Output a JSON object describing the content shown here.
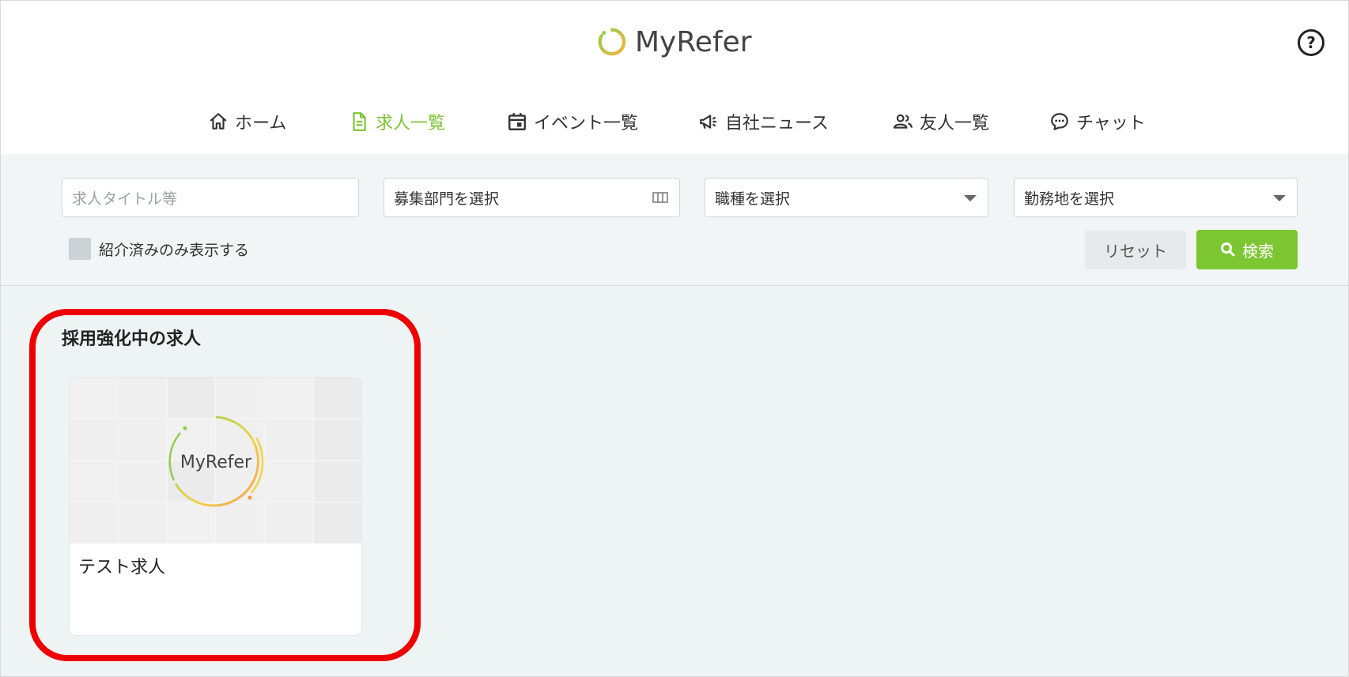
{
  "app": {
    "logo_text": "MyRefer",
    "help_label": "?"
  },
  "nav": {
    "items": [
      {
        "label": "ホーム",
        "icon": "home-icon",
        "active": false
      },
      {
        "label": "求人一覧",
        "icon": "document-icon",
        "active": true
      },
      {
        "label": "イベント一覧",
        "icon": "calendar-icon",
        "active": false
      },
      {
        "label": "自社ニュース",
        "icon": "megaphone-icon",
        "active": false
      },
      {
        "label": "友人一覧",
        "icon": "people-icon",
        "active": false
      },
      {
        "label": "チャット",
        "icon": "chat-icon",
        "active": false
      }
    ]
  },
  "filters": {
    "title_placeholder": "求人タイトル等",
    "department_value": "募集部門を選択",
    "job_type_value": "職種を選択",
    "location_value": "勤務地を選択",
    "referred_only_label": "紹介済みのみ表示する",
    "referred_only_checked": false,
    "reset_label": "リセット",
    "search_label": "検索"
  },
  "featured": {
    "title": "採用強化中の求人",
    "cards": [
      {
        "title": "テスト求人",
        "thumb_logo_text": "MyRefer"
      }
    ]
  },
  "colors": {
    "accent": "#7cc631",
    "highlight": "#ee0000",
    "background": "#eef3f3"
  }
}
